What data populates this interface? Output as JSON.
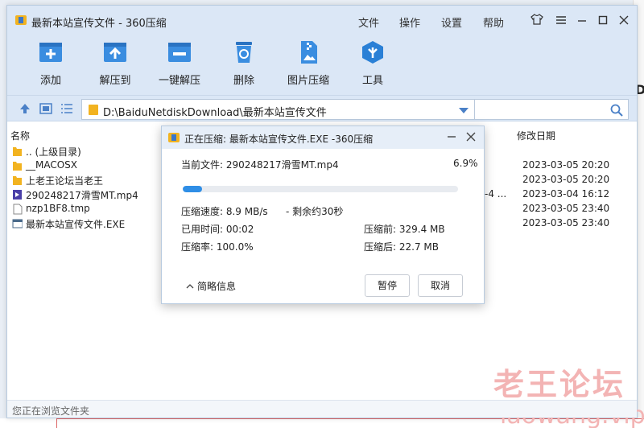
{
  "window": {
    "title": "最新本站宣传文件 - 360压缩",
    "menu": [
      "文件",
      "操作",
      "设置",
      "帮助"
    ]
  },
  "toolbar": {
    "items": [
      {
        "label": "添加",
        "icon": "add-icon"
      },
      {
        "label": "解压到",
        "icon": "extract-to-icon"
      },
      {
        "label": "一键解压",
        "icon": "one-click-extract-icon"
      },
      {
        "label": "删除",
        "icon": "delete-icon"
      },
      {
        "label": "图片压缩",
        "icon": "image-compress-icon"
      },
      {
        "label": "工具",
        "icon": "tools-icon"
      }
    ]
  },
  "path": {
    "value": "D:\\BaiduNetdiskDownload\\最新本站宣传文件",
    "search_placeholder": ""
  },
  "columns": {
    "name": "名称",
    "modified": "修改日期"
  },
  "files": [
    {
      "name": ".. (上级目录)",
      "date": "",
      "type": "folder",
      "extra": ""
    },
    {
      "name": "__MACOSX",
      "date": "2023-03-05 20:20",
      "type": "folder",
      "extra": ""
    },
    {
      "name": "上老王论坛当老王",
      "date": "2023-03-05 20:20",
      "type": "folder",
      "extra": ""
    },
    {
      "name": "290248217滑雪MT.mp4",
      "date": "2023-03-04 16:12",
      "type": "mp4",
      "extra": "-4 ..."
    },
    {
      "name": "nzp1BF8.tmp",
      "date": "2023-03-05 23:40",
      "type": "file",
      "extra": ""
    },
    {
      "name": "最新本站宣传文件.EXE",
      "date": "2023-03-05 23:40",
      "type": "exe",
      "extra": ""
    }
  ],
  "status": "您正在浏览文件夹",
  "watermark": {
    "cn": "老王论坛",
    "en": "laowang.vip"
  },
  "dialog": {
    "title": "正在压缩: 最新本站宣传文件.EXE -360压缩",
    "current_file_label": "当前文件: 290248217滑雪MT.mp4",
    "percent": "6.9%",
    "progress": 0.069,
    "speed": "压缩速度: 8.9 MB/s",
    "remaining": "- 剩余约30秒",
    "elapsed": "已用时间: 00:02",
    "before": "压缩前: 329.4 MB",
    "ratio": "压缩率: 100.0%",
    "after": "压缩后: 22.7 MB",
    "brief": "简略信息",
    "pause": "暂停",
    "cancel": "取消"
  },
  "colors": {
    "accent": "#2f8ee6",
    "folder": "#f2b320",
    "titlebar": "#dbe7f6"
  }
}
